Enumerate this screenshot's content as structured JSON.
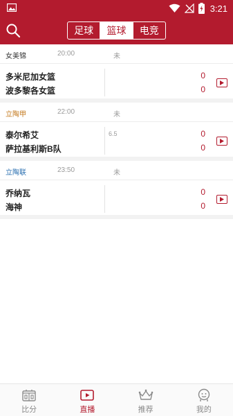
{
  "status_bar": {
    "time": "3:21"
  },
  "header": {
    "tabs": [
      {
        "label": "足球",
        "active": false
      },
      {
        "label": "篮球",
        "active": true
      },
      {
        "label": "电竞",
        "active": false
      }
    ]
  },
  "matches": [
    {
      "league": "女美锦",
      "league_color": "#333333",
      "time": "20:00",
      "status": "未",
      "home_team": "多米尼加女篮",
      "away_team": "波多黎各女篮",
      "handicap": "",
      "home_score": "0",
      "away_score": "0"
    },
    {
      "league": "立陶甲",
      "league_color": "#c47a1e",
      "time": "22:00",
      "status": "未",
      "home_team": "泰尔希艾",
      "away_team": "萨拉基利斯B队",
      "handicap": "6.5",
      "home_score": "0",
      "away_score": "0"
    },
    {
      "league": "立陶联",
      "league_color": "#2a6fb0",
      "time": "23:50",
      "status": "未",
      "home_team": "乔纳瓦",
      "away_team": "海神",
      "handicap": "",
      "home_score": "0",
      "away_score": "0"
    }
  ],
  "bottom_nav": [
    {
      "label": "比分",
      "icon": "scoreboard-icon",
      "active": false
    },
    {
      "label": "直播",
      "icon": "play-tv-icon",
      "active": true
    },
    {
      "label": "推荐",
      "icon": "crown-icon",
      "active": false
    },
    {
      "label": "我的",
      "icon": "user-icon",
      "active": false
    }
  ],
  "colors": {
    "brand": "#b31b2e"
  }
}
